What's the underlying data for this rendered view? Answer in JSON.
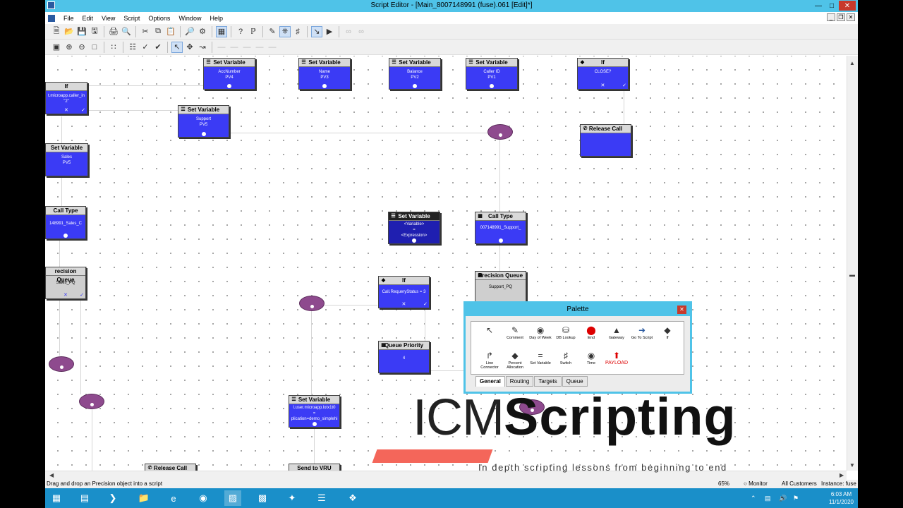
{
  "window": {
    "title": "Script Editor - [Main_8007148991 (fuse).061 [Edit]*]"
  },
  "menu": [
    "File",
    "Edit",
    "View",
    "Script",
    "Options",
    "Window",
    "Help"
  ],
  "nodes": {
    "if1": {
      "header": "If",
      "lines": [
        "t.microapp.caller_in",
        "\"2\""
      ]
    },
    "sv_acc": {
      "header": "Set Variable",
      "lines": [
        "AccNumber",
        "PV4"
      ]
    },
    "sv_name": {
      "header": "Set Variable",
      "lines": [
        "Name",
        "PV3"
      ]
    },
    "sv_bal": {
      "header": "Set Variable",
      "lines": [
        "Balance",
        "PV2"
      ]
    },
    "sv_cid": {
      "header": "Set Variable",
      "lines": [
        "Caller ID",
        "PV1"
      ]
    },
    "if_close": {
      "header": "If",
      "lines": [
        "CLOSE?"
      ]
    },
    "sv_support": {
      "header": "Set Variable",
      "lines": [
        "Support",
        "PV5"
      ]
    },
    "release1": {
      "header": "Release Call",
      "lines": []
    },
    "sv_sales": {
      "header": "Set Variable",
      "lines": [
        "Sales",
        "PV5"
      ]
    },
    "ct_sales": {
      "header": "Call Type",
      "lines": [
        "148991_Sales_C"
      ]
    },
    "sv_new": {
      "header": "Set Variable",
      "lines": [
        "<Variable>",
        "=",
        "<Expression>"
      ]
    },
    "ct_support": {
      "header": "Call Type",
      "lines": [
        "007148991_Support_"
      ]
    },
    "pq_sales": {
      "header": "recision Queue",
      "lines": [
        "Sales_PQ"
      ]
    },
    "pq_support": {
      "header": "Precision Queue",
      "lines": [
        "Support_PQ"
      ]
    },
    "if_requery": {
      "header": "If",
      "lines": [
        "Call.RequeryStatus = 3"
      ]
    },
    "qp": {
      "header": "Queue Priority",
      "lines": [
        "4"
      ]
    },
    "sv_user": {
      "header": "Set Variable",
      "lines": [
        "l.user.microapp.lotx1t0",
        "=",
        "plication=demo_simplehi"
      ]
    },
    "release2": {
      "header": "Release Call",
      "lines": []
    },
    "send_vru": {
      "header": "Send to VRU",
      "lines": []
    }
  },
  "palette": {
    "title": "Palette",
    "items": [
      {
        "label": "",
        "icon": "pointer-icon"
      },
      {
        "label": "Comment",
        "icon": "comment-icon"
      },
      {
        "label": "Day of Week",
        "icon": "day-of-week-icon"
      },
      {
        "label": "DB Lookup",
        "icon": "db-lookup-icon"
      },
      {
        "label": "End",
        "icon": "end-icon"
      },
      {
        "label": "Gateway",
        "icon": "gateway-icon"
      },
      {
        "label": "Go To Script",
        "icon": "goto-script-icon"
      },
      {
        "label": "If",
        "icon": "if-icon"
      },
      {
        "label": "Line Connector",
        "icon": "line-connector-icon"
      },
      {
        "label": "Percent Allocation",
        "icon": "percent-allocation-icon"
      },
      {
        "label": "Set Variable",
        "icon": "set-variable-icon"
      },
      {
        "label": "Switch",
        "icon": "switch-icon"
      },
      {
        "label": "Time",
        "icon": "time-icon"
      },
      {
        "label": "PAYLOAD",
        "icon": "payload-icon"
      }
    ],
    "tabs": [
      "General",
      "Routing",
      "Targets",
      "Queue"
    ],
    "active_tab": "General"
  },
  "status": {
    "message": "Drag and drop an Precision object into a script",
    "zoom": "65%",
    "monitor": "Monitor",
    "customers": "All Customers",
    "instance": "Instance: fuse"
  },
  "clock": {
    "time": "6:03 AM",
    "date": "11/1/2020"
  },
  "overlay": {
    "title_thin": "ICM",
    "title_bold": "Scripting",
    "subtitle": "In depth scripting lessons from beginning to end"
  }
}
